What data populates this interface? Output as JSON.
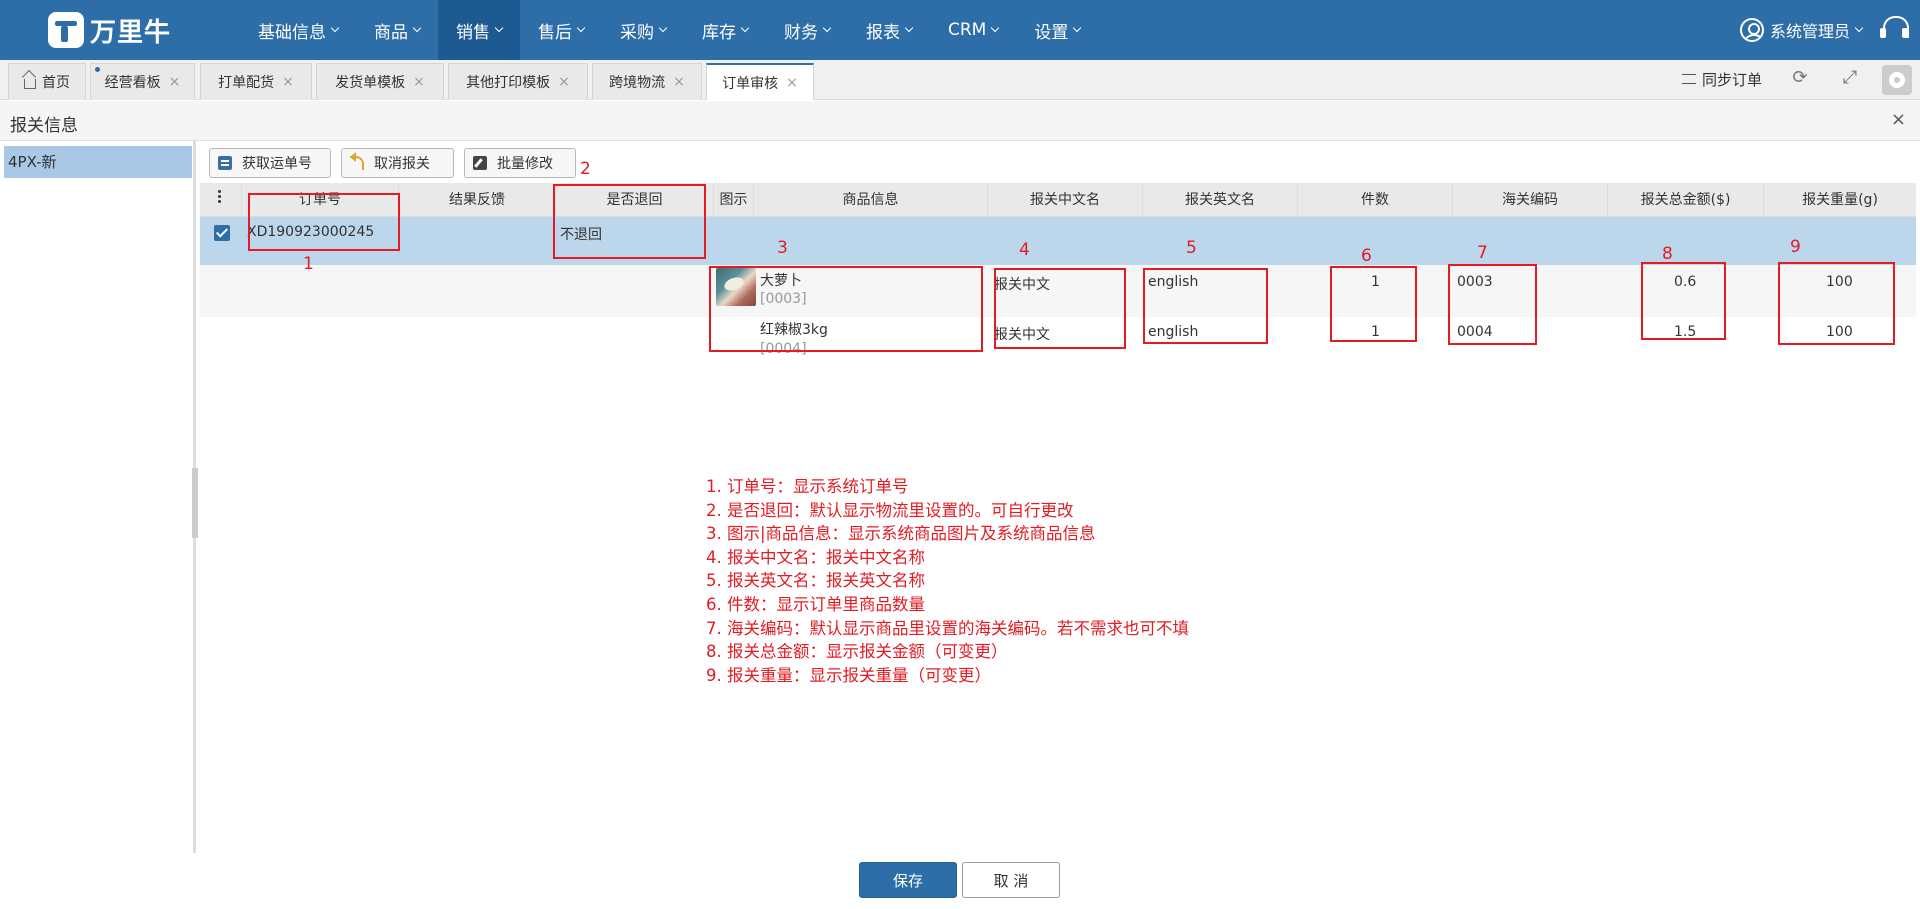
{
  "brand": {
    "name": "万里牛"
  },
  "nav": {
    "items": [
      "基础信息",
      "商品",
      "销售",
      "售后",
      "采购",
      "库存",
      "财务",
      "报表",
      "CRM",
      "设置"
    ],
    "active_index": 2,
    "user": "系统管理员"
  },
  "tabs": {
    "home": "首页",
    "items": [
      "经营看板",
      "打单配货",
      "发货单模板",
      "其他打印模板",
      "跨境物流",
      "订单审核"
    ],
    "active": "订单审核",
    "close_glyph": "×",
    "sync_label": "同步订单"
  },
  "dialog": {
    "title": "报关信息",
    "close_glyph": "×"
  },
  "sidebar": {
    "items": [
      "4PX-新"
    ]
  },
  "toolbar": {
    "get_tracking": "获取运单号",
    "cancel_customs": "取消报关",
    "batch_edit": "批量修改"
  },
  "table": {
    "columns": [
      "订单号",
      "结果反馈",
      "是否退回",
      "图示",
      "商品信息",
      "报关中文名",
      "报关英文名",
      "件数",
      "海关编码",
      "报关总金额($)",
      "报关重量(g)"
    ],
    "order": {
      "order_no": "XD190923000245",
      "feedback": "",
      "return": "不退回",
      "checked": true
    },
    "items": [
      {
        "name": "大萝卜",
        "code": "[0003]",
        "cn_name": "报关中文",
        "en_name": "english",
        "qty": "1",
        "hs_code": "0003",
        "amount": "0.6",
        "weight": "100"
      },
      {
        "name": "红辣椒3kg",
        "code": "[0004]",
        "cn_name": "报关中文",
        "en_name": "english",
        "qty": "1",
        "hs_code": "0004",
        "amount": "1.5",
        "weight": "100"
      }
    ]
  },
  "annotations": {
    "numbers": [
      "1",
      "2",
      "3",
      "4",
      "5",
      "6",
      "7",
      "8",
      "9"
    ],
    "notes": [
      "1. 订单号：显示系统订单号",
      "2. 是否退回：默认显示物流里设置的。可自行更改",
      "3. 图示|商品信息：显示系统商品图片及系统商品信息",
      "4. 报关中文名：报关中文名称",
      "5. 报关英文名：报关英文名称",
      "6. 件数：显示订单里商品数量",
      "7. 海关编码：默认显示商品里设置的海关编码。若不需求也可不填",
      "8. 报关总金额：显示报关金额（可变更）",
      "9. 报关重量：显示报关重量（可变更）"
    ],
    "color": "#e41b23"
  },
  "footer": {
    "save": "保存",
    "cancel": "取 消"
  },
  "colors": {
    "nav_bg": "#2e6ea8",
    "nav_active": "#1c5a91",
    "row_selected": "#bcd6ec",
    "sidebar_selected": "#a9c8e6"
  }
}
